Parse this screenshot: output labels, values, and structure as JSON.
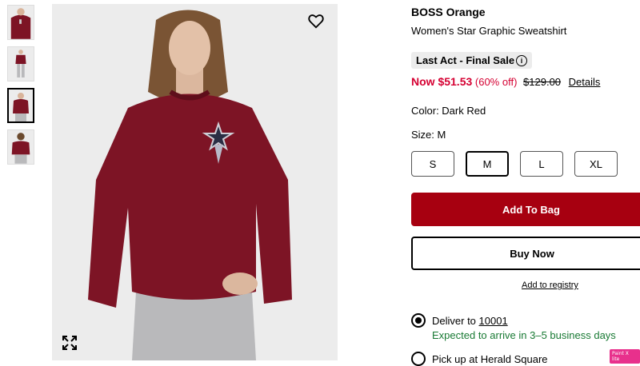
{
  "gallery": {
    "thumbnails": [
      {
        "name": "thumb-front",
        "selected": false
      },
      {
        "name": "thumb-full-body",
        "selected": false
      },
      {
        "name": "thumb-front-close",
        "selected": true
      },
      {
        "name": "thumb-back",
        "selected": false
      }
    ],
    "main_image_colors": {
      "sweatshirt": "#7d1425",
      "jeans": "#b9b9bb",
      "background": "#ececec"
    }
  },
  "product": {
    "brand": "BOSS Orange",
    "name": "Women's Star Graphic Sweatshirt",
    "badge": "Last Act - Final Sale",
    "badge_icon": "i",
    "price_now": "Now $51.53",
    "price_discount": "(60% off)",
    "price_original": "$129.00",
    "details_link": "Details",
    "color_label": "Color: Dark Red",
    "size_label": "Size: M",
    "sizes": [
      "S",
      "M",
      "L",
      "XL"
    ],
    "selected_size": "M"
  },
  "actions": {
    "add_to_bag": "Add To Bag",
    "buy_now": "Buy Now",
    "add_to_registry": "Add to registry"
  },
  "fulfillment": {
    "deliver_prefix": "Deliver to ",
    "deliver_zip": "10001",
    "expected": "Expected to arrive in 3–5 business days",
    "pickup": "Pick up at Herald Square"
  },
  "overlay_badge": "Paint X lite",
  "colors": {
    "sale_red": "#d50032",
    "bag_button": "#a70010",
    "delivery_green": "#197a34"
  }
}
